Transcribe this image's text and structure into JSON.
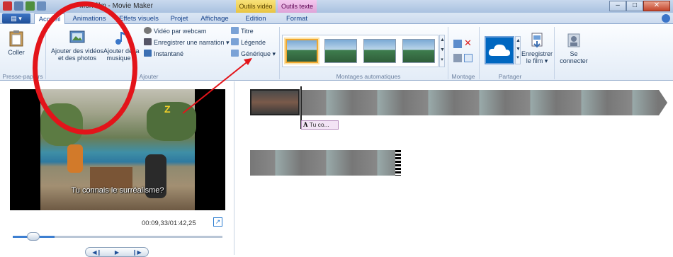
{
  "window": {
    "title": "Mon film - Movie Maker"
  },
  "context_tabs": {
    "video": "Outils vidéo",
    "text": "Outils texte"
  },
  "tabs": [
    "Accueil",
    "Animations",
    "Effets visuels",
    "Projet",
    "Affichage",
    "Edition",
    "Format"
  ],
  "ribbon": {
    "paste": "Coller",
    "add_videos": "Ajouter des vidéos",
    "add_videos_2": "et des photos",
    "add_music": "Ajouter de la",
    "add_music_2": "musique",
    "webcam": "Vidéo par webcam",
    "narration": "Enregistrer une narration",
    "snapshot": "Instantané",
    "title": "Titre",
    "caption": "Légende",
    "credits": "Générique",
    "save_movie": "Enregistrer",
    "save_movie_2": "le film",
    "sign_in": "Se",
    "sign_in_2": "connecter",
    "groups": {
      "clipboard": "Presse-papiers",
      "add": "Ajouter",
      "automovie": "Montages automatiques",
      "editing": "Montage",
      "share": "Partager"
    }
  },
  "preview": {
    "subtitle": "Tu connais le surréalisme?",
    "timecode": "00:09,33/01:42,25",
    "progress": 0.2
  },
  "timeline": {
    "caption_label": "Tu co..."
  },
  "colors": {
    "accent": "#1f4f98",
    "annotation": "#e3141a",
    "context_video": "#e8c442",
    "context_text": "#dea3d8"
  }
}
